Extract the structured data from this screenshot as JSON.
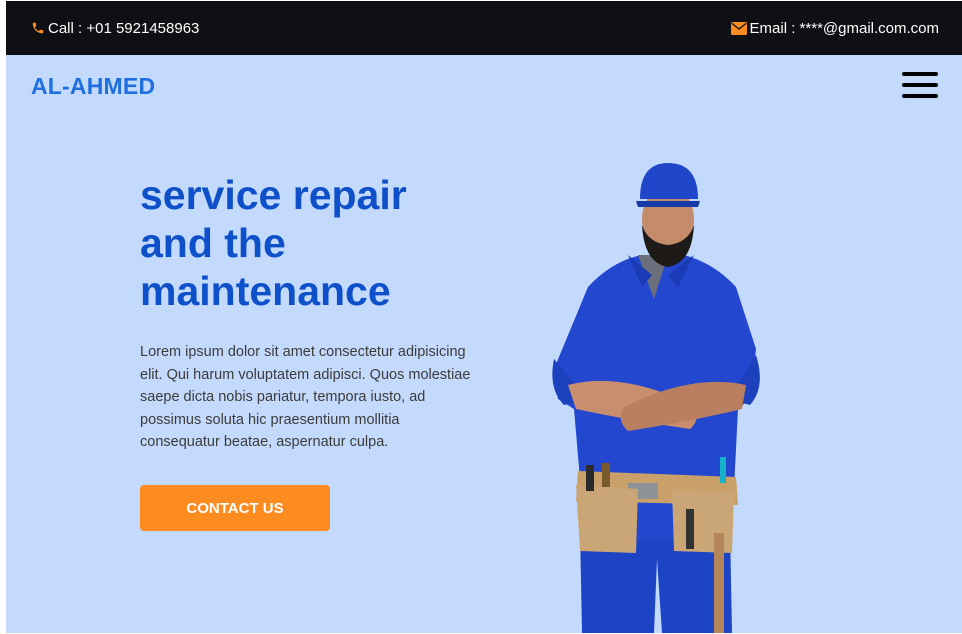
{
  "topbar": {
    "phone_icon": "phone-icon",
    "phone_text": "Call : +01 5921458963",
    "email_icon": "envelope-icon",
    "email_text": "Email : ****@gmail.com.com"
  },
  "header": {
    "brand": "AL-AHMED",
    "menu_icon": "hamburger-icon"
  },
  "hero": {
    "title": "service repair and the maintenance",
    "description": "Lorem ipsum dolor sit amet consectetur adipisicing elit. Qui harum voluptatem adipisci. Quos molestiae saepe dicta nobis pariatur, tempora iusto, ad possimus soluta hic praesentium mollitia consequatur beatae, aspernatur culpa.",
    "cta_label": "CONTACT US"
  },
  "colors": {
    "accent": "#fc8c1f",
    "brand": "#1f6fe0",
    "title": "#0d50c9",
    "background": "#c4dafd",
    "topbar": "#0f1014"
  }
}
